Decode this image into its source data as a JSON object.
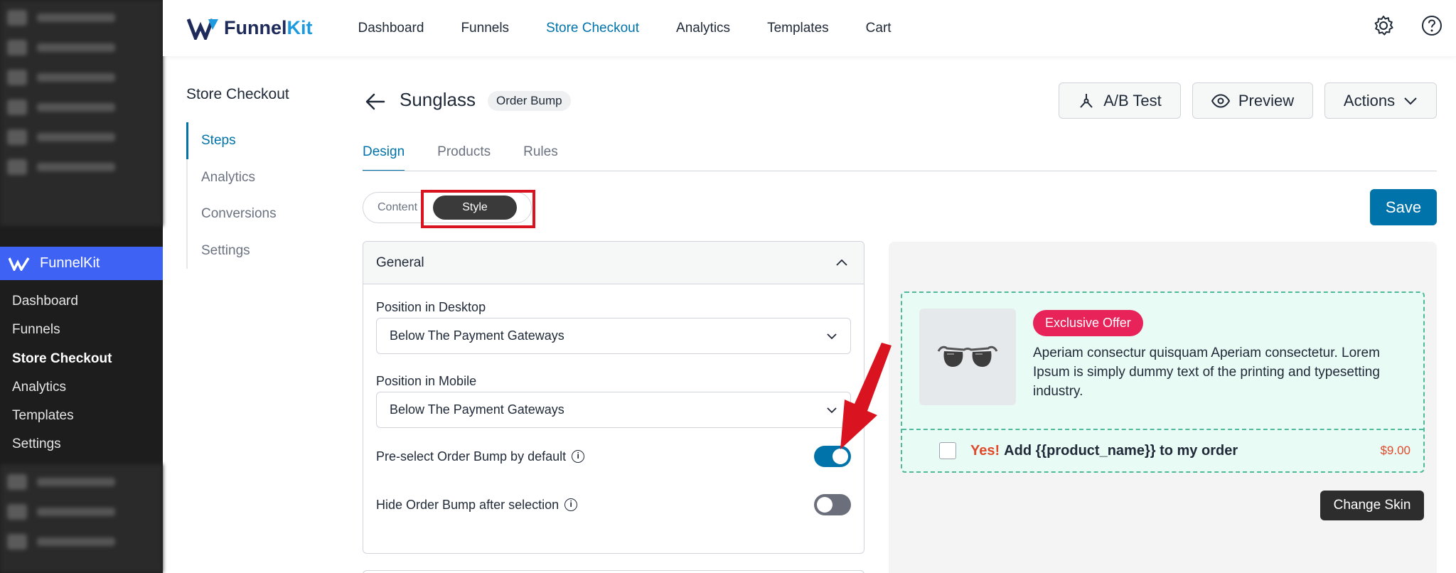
{
  "wp_sidebar": {
    "plugin_label": "FunnelKit",
    "items": [
      {
        "label": "Dashboard",
        "active": false
      },
      {
        "label": "Funnels",
        "active": false
      },
      {
        "label": "Store Checkout",
        "active": true
      },
      {
        "label": "Analytics",
        "active": false
      },
      {
        "label": "Templates",
        "active": false
      },
      {
        "label": "Settings",
        "active": false
      }
    ]
  },
  "topbar": {
    "brand_main": "Funnel",
    "brand_accent": "Kit",
    "nav": [
      {
        "label": "Dashboard",
        "active": false
      },
      {
        "label": "Funnels",
        "active": false
      },
      {
        "label": "Store Checkout",
        "active": true
      },
      {
        "label": "Analytics",
        "active": false
      },
      {
        "label": "Templates",
        "active": false
      },
      {
        "label": "Cart",
        "active": false
      }
    ],
    "icons": [
      "gear-icon",
      "help-icon"
    ]
  },
  "store_menu": {
    "title": "Store Checkout",
    "items": [
      {
        "label": "Steps",
        "active": true
      },
      {
        "label": "Analytics",
        "active": false
      },
      {
        "label": "Conversions",
        "active": false
      },
      {
        "label": "Settings",
        "active": false
      }
    ]
  },
  "header": {
    "title": "Sunglass",
    "badge": "Order Bump",
    "ab_test": "A/B Test",
    "preview": "Preview",
    "actions": "Actions"
  },
  "tabs": [
    {
      "label": "Design",
      "active": true
    },
    {
      "label": "Products",
      "active": false
    },
    {
      "label": "Rules",
      "active": false
    }
  ],
  "segment": {
    "content": "Content",
    "style": "Style",
    "selected": "Style"
  },
  "save_label": "Save",
  "general": {
    "title": "General",
    "desktop_label": "Position in Desktop",
    "desktop_value": "Below The Payment Gateways",
    "mobile_label": "Position in Mobile",
    "mobile_value": "Below The Payment Gateways",
    "preselect_label": "Pre-select Order Bump by default",
    "preselect_on": true,
    "hide_label": "Hide Order Bump after selection",
    "hide_on": false
  },
  "bump_preview": {
    "offer_badge": "Exclusive Offer",
    "description": "Aperiam consectur quisquam Aperiam consectetur. Lorem Ipsum is simply dummy text of the printing and typesetting industry.",
    "yes": "Yes!",
    "add_text": "Add {{product_name}} to my order",
    "price": "$9.00",
    "change_skin": "Change Skin"
  },
  "colors": {
    "accent": "#0073aa",
    "funnelkit_blue": "#3e62f4",
    "offer_pink": "#e8235a",
    "bump_bg": "#e9fbf5",
    "bump_border": "#4fb99a",
    "highlight_red": "#d9131f"
  }
}
